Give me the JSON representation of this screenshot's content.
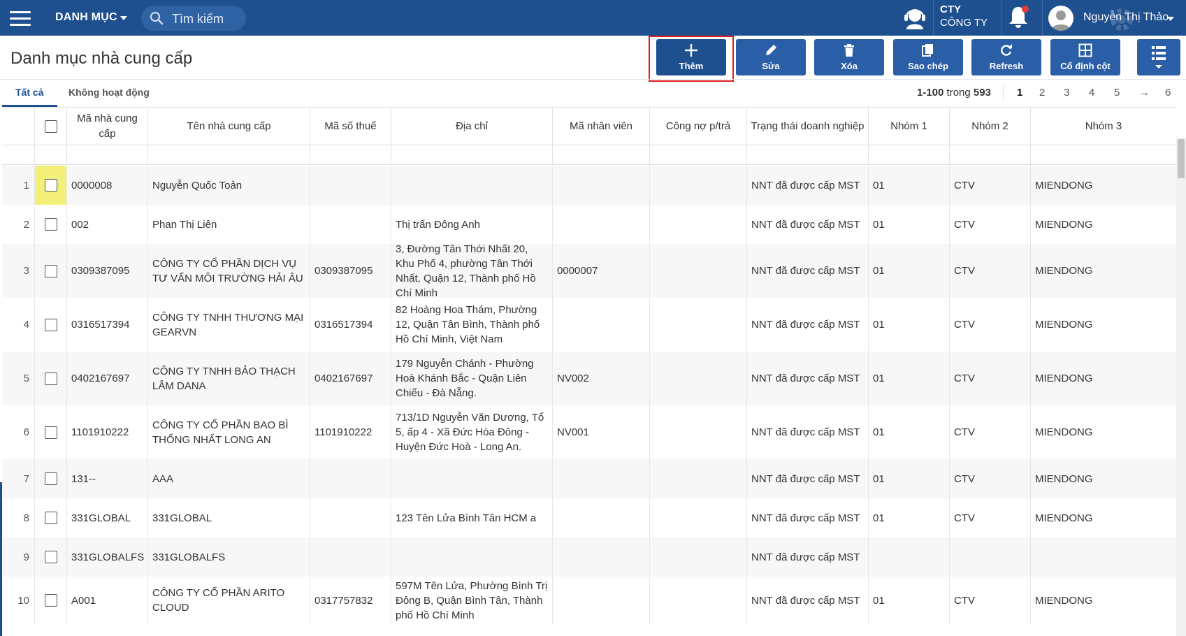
{
  "topbar": {
    "menu_label": "DANH MỤC",
    "search_placeholder": "Tìm kiếm",
    "company_code": "CTY",
    "company_name": "CÔNG TY",
    "user_name": "Nguyễn Thị Thảo"
  },
  "page": {
    "title": "Danh mục nhà cung cấp"
  },
  "toolbar": {
    "add": "Thêm",
    "edit": "Sửa",
    "delete": "Xóa",
    "copy": "Sao chép",
    "refresh": "Refresh",
    "pin_columns": "Cố định cột"
  },
  "tabs": {
    "all": "Tất cả",
    "inactive": "Không hoạt động"
  },
  "paging": {
    "range": "1-100",
    "of_word": "trong",
    "total": "593",
    "pages": [
      "1",
      "2",
      "3",
      "4",
      "5",
      "→",
      "6"
    ],
    "current": "1"
  },
  "columns": [
    "Mã nhà cung cấp",
    "Tên nhà cung cấp",
    "Mã số thuế",
    "Địa chỉ",
    "Mã nhân viên",
    "Công nợ p/trả",
    "Trạng thái doanh nghiệp",
    "Nhóm 1",
    "Nhóm 2",
    "Nhóm 3"
  ],
  "rows": [
    {
      "n": "1",
      "code": "0000008",
      "name": "Nguyễn Quốc Toản",
      "tax": "",
      "address": "",
      "staff": "",
      "debt": "",
      "status": "NNT đã được cấp MST",
      "g1": "01",
      "g2": "CTV",
      "g3": "MIENDONG"
    },
    {
      "n": "2",
      "code": "002",
      "name": "Phan Thị Liên",
      "tax": "",
      "address": "Thị trấn Đông Anh",
      "staff": "",
      "debt": "",
      "status": "NNT đã được cấp MST",
      "g1": "01",
      "g2": "CTV",
      "g3": "MIENDONG"
    },
    {
      "n": "3",
      "code": "0309387095",
      "name": "CÔNG TY CỔ PHẦN DỊCH VỤ TƯ VẤN MÔI TRƯỜNG HẢI ÂU",
      "tax": "0309387095",
      "address": "3, Đường Tân Thới Nhất 20,  Khu Phố 4, phường Tân Thới Nhất, Quận 12, Thành phố Hồ Chí Minh",
      "staff": "0000007",
      "debt": "",
      "status": "NNT đã được cấp MST",
      "g1": "01",
      "g2": "CTV",
      "g3": "MIENDONG"
    },
    {
      "n": "4",
      "code": "0316517394",
      "name": "CÔNG TY TNHH THƯƠNG MẠI GEARVN",
      "tax": "0316517394",
      "address": "82 Hoàng Hoa Thám, Phường 12, Quận Tân Bình, Thành phố Hồ Chí Minh, Việt Nam",
      "staff": "",
      "debt": "",
      "status": "NNT đã được cấp MST",
      "g1": "01",
      "g2": "CTV",
      "g3": "MIENDONG"
    },
    {
      "n": "5",
      "code": "0402167697",
      "name": "CÔNG TY TNHH BẢO THẠCH LÂM DANA",
      "tax": "0402167697",
      "address": "179 Nguyễn Chánh - Phường Hoà Khánh Bắc - Quận Liên Chiểu - Đà Nẵng.",
      "staff": "NV002",
      "debt": "",
      "status": "NNT đã được cấp MST",
      "g1": "01",
      "g2": "CTV",
      "g3": "MIENDONG"
    },
    {
      "n": "6",
      "code": "1101910222",
      "name": "CÔNG TY CỔ PHẦN BAO BÌ THỐNG NHẤT LONG AN",
      "tax": "1101910222",
      "address": "713/1D Nguyễn Văn Dương, Tổ 5, ấp 4 - Xã Đức Hòa Đông - Huyện Đức Hoà - Long An.",
      "staff": "NV001",
      "debt": "",
      "status": "NNT đã được cấp MST",
      "g1": "01",
      "g2": "CTV",
      "g3": "MIENDONG"
    },
    {
      "n": "7",
      "code": "131--",
      "name": "AAA",
      "tax": "",
      "address": "",
      "staff": "",
      "debt": "",
      "status": "NNT đã được cấp MST",
      "g1": "01",
      "g2": "CTV",
      "g3": "MIENDONG"
    },
    {
      "n": "8",
      "code": "331GLOBAL",
      "name": "331GLOBAL",
      "tax": "",
      "address": "123 Tên Lửa Bình Tân HCM a",
      "staff": "",
      "debt": "",
      "status": "NNT đã được cấp MST",
      "g1": "01",
      "g2": "CTV",
      "g3": "MIENDONG"
    },
    {
      "n": "9",
      "code": "331GLOBALFS",
      "name": "331GLOBALFS",
      "tax": "",
      "address": "",
      "staff": "",
      "debt": "",
      "status": "NNT đã được cấp MST",
      "g1": "",
      "g2": "",
      "g3": ""
    },
    {
      "n": "10",
      "code": "A001",
      "name": "CÔNG TY CỔ PHẦN ARITO CLOUD",
      "tax": "0317757832",
      "address": "597M Tên Lửa, Phường Bình Trị Đông B, Quận Bình Tân, Thành phố Hồ Chí Minh",
      "staff": "",
      "debt": "",
      "status": "NNT đã được cấp MST",
      "g1": "01",
      "g2": "CTV",
      "g3": "MIENDONG"
    }
  ]
}
